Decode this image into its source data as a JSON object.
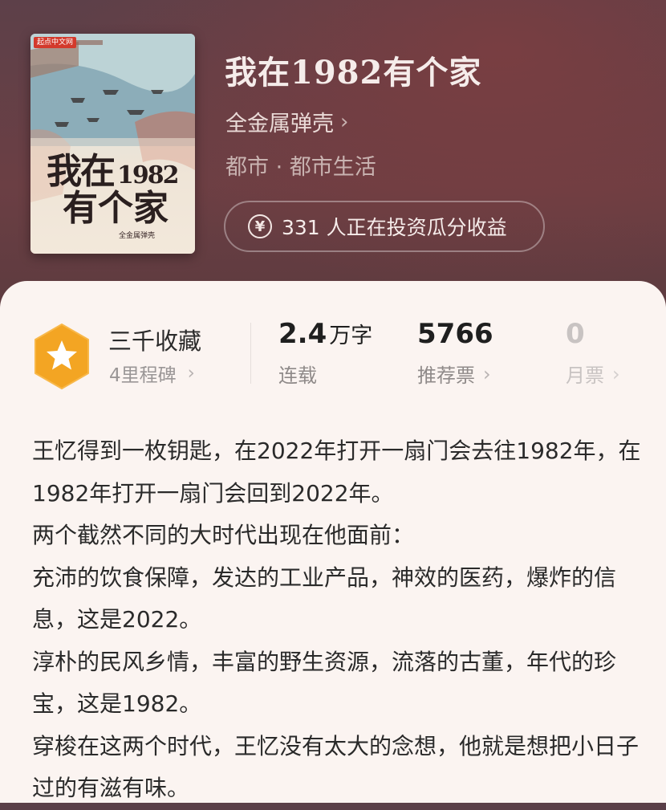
{
  "book": {
    "title": "我在1982有个家",
    "author": "全金属弹壳",
    "genre": "都市 · 都市生活",
    "invest_text": "331 人正在投资瓜分收益",
    "cover": {
      "logo": "起点中文网",
      "title_line1": "我在",
      "title_year": "1982",
      "title_line2": "有个家",
      "author": "全金属弹壳"
    }
  },
  "stats": {
    "badge_name": "三千收藏",
    "badge_sub": "4里程碑",
    "words": {
      "value": "2.4",
      "unit": "万字",
      "label": "连载"
    },
    "recommend": {
      "value": "5766",
      "label": "推荐票"
    },
    "monthly": {
      "value": "0",
      "label": "月票"
    }
  },
  "description": [
    "王忆得到一枚钥匙，在2022年打开一扇门会去往1982年，在1982年打开一扇门会回到2022年。",
    "两个截然不同的大时代出现在他面前：",
    "充沛的饮食保障，发达的工业产品，神效的医药，爆炸的信息，这是2022。",
    "淳朴的民风乡情，丰富的野生资源，流落的古董，年代的珍宝，这是1982。",
    "穿梭在这两个时代，王忆没有太大的念想，他就是想把小日子过的有滋有味。"
  ],
  "icons": {
    "chevron": "chevron-right-icon",
    "coin": "yen-coin-icon",
    "badge": "star-hexagon-badge-icon"
  },
  "colors": {
    "badge": "#f2a623",
    "card_bg": "#fbf4f1",
    "header_bg": "#5e3c43"
  }
}
